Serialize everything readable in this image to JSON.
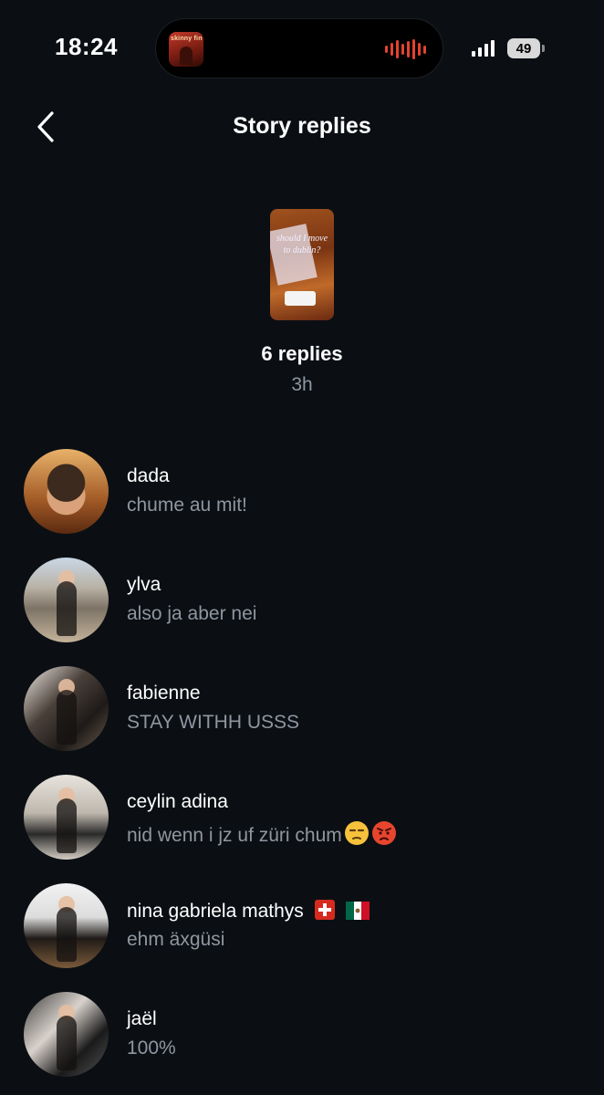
{
  "status_bar": {
    "time": "18:24",
    "battery": "49",
    "now_playing_art_text": "skinny fin"
  },
  "header": {
    "title": "Story replies",
    "back_icon": "chevron-left-icon"
  },
  "story": {
    "thumbnail_text": "should I move to dublin?",
    "replies_count": "6 replies",
    "age": "3h"
  },
  "replies": [
    {
      "name": "dada",
      "text": "chume au mit!"
    },
    {
      "name": "ylva",
      "text": "also ja aber nei"
    },
    {
      "name": "fabienne",
      "text": "STAY WITHH USSS"
    },
    {
      "name": "ceylin adina",
      "text": "nid wenn i jz uf züri chum",
      "emojis": [
        "unamused-face",
        "angry-face"
      ]
    },
    {
      "name": "nina gabriela mathys",
      "text": "ehm äxgüsi",
      "flags": [
        "switzerland-flag",
        "mexico-flag"
      ]
    },
    {
      "name": "jaël",
      "text": "100%"
    }
  ],
  "colors": {
    "background": "#0b0f14",
    "secondary_text": "#8e96a0",
    "waveform": "#e2442f"
  }
}
